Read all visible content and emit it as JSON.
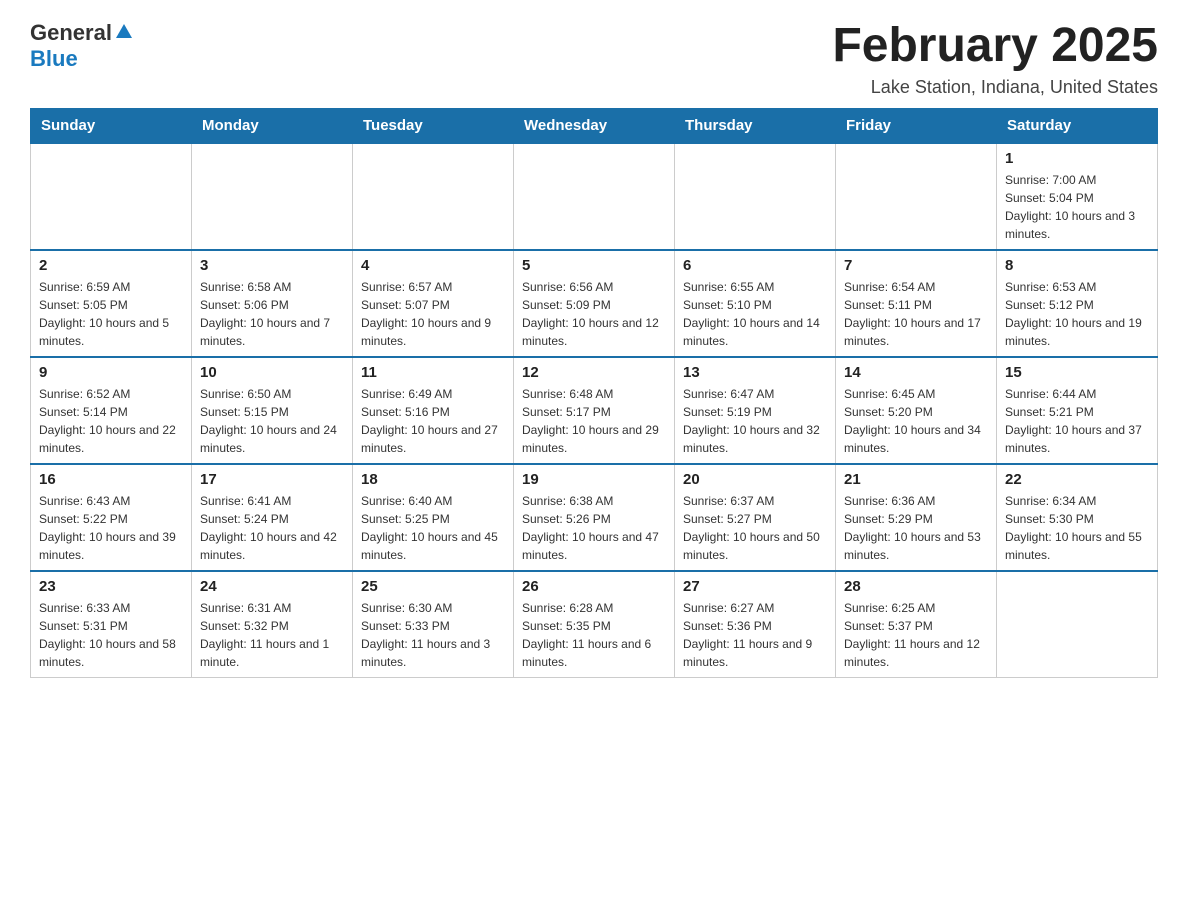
{
  "logo": {
    "general": "General",
    "blue": "Blue"
  },
  "title": "February 2025",
  "subtitle": "Lake Station, Indiana, United States",
  "days_of_week": [
    "Sunday",
    "Monday",
    "Tuesday",
    "Wednesday",
    "Thursday",
    "Friday",
    "Saturday"
  ],
  "weeks": [
    [
      {
        "day": "",
        "sunrise": "",
        "sunset": "",
        "daylight": ""
      },
      {
        "day": "",
        "sunrise": "",
        "sunset": "",
        "daylight": ""
      },
      {
        "day": "",
        "sunrise": "",
        "sunset": "",
        "daylight": ""
      },
      {
        "day": "",
        "sunrise": "",
        "sunset": "",
        "daylight": ""
      },
      {
        "day": "",
        "sunrise": "",
        "sunset": "",
        "daylight": ""
      },
      {
        "day": "",
        "sunrise": "",
        "sunset": "",
        "daylight": ""
      },
      {
        "day": "1",
        "sunrise": "Sunrise: 7:00 AM",
        "sunset": "Sunset: 5:04 PM",
        "daylight": "Daylight: 10 hours and 3 minutes."
      }
    ],
    [
      {
        "day": "2",
        "sunrise": "Sunrise: 6:59 AM",
        "sunset": "Sunset: 5:05 PM",
        "daylight": "Daylight: 10 hours and 5 minutes."
      },
      {
        "day": "3",
        "sunrise": "Sunrise: 6:58 AM",
        "sunset": "Sunset: 5:06 PM",
        "daylight": "Daylight: 10 hours and 7 minutes."
      },
      {
        "day": "4",
        "sunrise": "Sunrise: 6:57 AM",
        "sunset": "Sunset: 5:07 PM",
        "daylight": "Daylight: 10 hours and 9 minutes."
      },
      {
        "day": "5",
        "sunrise": "Sunrise: 6:56 AM",
        "sunset": "Sunset: 5:09 PM",
        "daylight": "Daylight: 10 hours and 12 minutes."
      },
      {
        "day": "6",
        "sunrise": "Sunrise: 6:55 AM",
        "sunset": "Sunset: 5:10 PM",
        "daylight": "Daylight: 10 hours and 14 minutes."
      },
      {
        "day": "7",
        "sunrise": "Sunrise: 6:54 AM",
        "sunset": "Sunset: 5:11 PM",
        "daylight": "Daylight: 10 hours and 17 minutes."
      },
      {
        "day": "8",
        "sunrise": "Sunrise: 6:53 AM",
        "sunset": "Sunset: 5:12 PM",
        "daylight": "Daylight: 10 hours and 19 minutes."
      }
    ],
    [
      {
        "day": "9",
        "sunrise": "Sunrise: 6:52 AM",
        "sunset": "Sunset: 5:14 PM",
        "daylight": "Daylight: 10 hours and 22 minutes."
      },
      {
        "day": "10",
        "sunrise": "Sunrise: 6:50 AM",
        "sunset": "Sunset: 5:15 PM",
        "daylight": "Daylight: 10 hours and 24 minutes."
      },
      {
        "day": "11",
        "sunrise": "Sunrise: 6:49 AM",
        "sunset": "Sunset: 5:16 PM",
        "daylight": "Daylight: 10 hours and 27 minutes."
      },
      {
        "day": "12",
        "sunrise": "Sunrise: 6:48 AM",
        "sunset": "Sunset: 5:17 PM",
        "daylight": "Daylight: 10 hours and 29 minutes."
      },
      {
        "day": "13",
        "sunrise": "Sunrise: 6:47 AM",
        "sunset": "Sunset: 5:19 PM",
        "daylight": "Daylight: 10 hours and 32 minutes."
      },
      {
        "day": "14",
        "sunrise": "Sunrise: 6:45 AM",
        "sunset": "Sunset: 5:20 PM",
        "daylight": "Daylight: 10 hours and 34 minutes."
      },
      {
        "day": "15",
        "sunrise": "Sunrise: 6:44 AM",
        "sunset": "Sunset: 5:21 PM",
        "daylight": "Daylight: 10 hours and 37 minutes."
      }
    ],
    [
      {
        "day": "16",
        "sunrise": "Sunrise: 6:43 AM",
        "sunset": "Sunset: 5:22 PM",
        "daylight": "Daylight: 10 hours and 39 minutes."
      },
      {
        "day": "17",
        "sunrise": "Sunrise: 6:41 AM",
        "sunset": "Sunset: 5:24 PM",
        "daylight": "Daylight: 10 hours and 42 minutes."
      },
      {
        "day": "18",
        "sunrise": "Sunrise: 6:40 AM",
        "sunset": "Sunset: 5:25 PM",
        "daylight": "Daylight: 10 hours and 45 minutes."
      },
      {
        "day": "19",
        "sunrise": "Sunrise: 6:38 AM",
        "sunset": "Sunset: 5:26 PM",
        "daylight": "Daylight: 10 hours and 47 minutes."
      },
      {
        "day": "20",
        "sunrise": "Sunrise: 6:37 AM",
        "sunset": "Sunset: 5:27 PM",
        "daylight": "Daylight: 10 hours and 50 minutes."
      },
      {
        "day": "21",
        "sunrise": "Sunrise: 6:36 AM",
        "sunset": "Sunset: 5:29 PM",
        "daylight": "Daylight: 10 hours and 53 minutes."
      },
      {
        "day": "22",
        "sunrise": "Sunrise: 6:34 AM",
        "sunset": "Sunset: 5:30 PM",
        "daylight": "Daylight: 10 hours and 55 minutes."
      }
    ],
    [
      {
        "day": "23",
        "sunrise": "Sunrise: 6:33 AM",
        "sunset": "Sunset: 5:31 PM",
        "daylight": "Daylight: 10 hours and 58 minutes."
      },
      {
        "day": "24",
        "sunrise": "Sunrise: 6:31 AM",
        "sunset": "Sunset: 5:32 PM",
        "daylight": "Daylight: 11 hours and 1 minute."
      },
      {
        "day": "25",
        "sunrise": "Sunrise: 6:30 AM",
        "sunset": "Sunset: 5:33 PM",
        "daylight": "Daylight: 11 hours and 3 minutes."
      },
      {
        "day": "26",
        "sunrise": "Sunrise: 6:28 AM",
        "sunset": "Sunset: 5:35 PM",
        "daylight": "Daylight: 11 hours and 6 minutes."
      },
      {
        "day": "27",
        "sunrise": "Sunrise: 6:27 AM",
        "sunset": "Sunset: 5:36 PM",
        "daylight": "Daylight: 11 hours and 9 minutes."
      },
      {
        "day": "28",
        "sunrise": "Sunrise: 6:25 AM",
        "sunset": "Sunset: 5:37 PM",
        "daylight": "Daylight: 11 hours and 12 minutes."
      },
      {
        "day": "",
        "sunrise": "",
        "sunset": "",
        "daylight": ""
      }
    ]
  ]
}
